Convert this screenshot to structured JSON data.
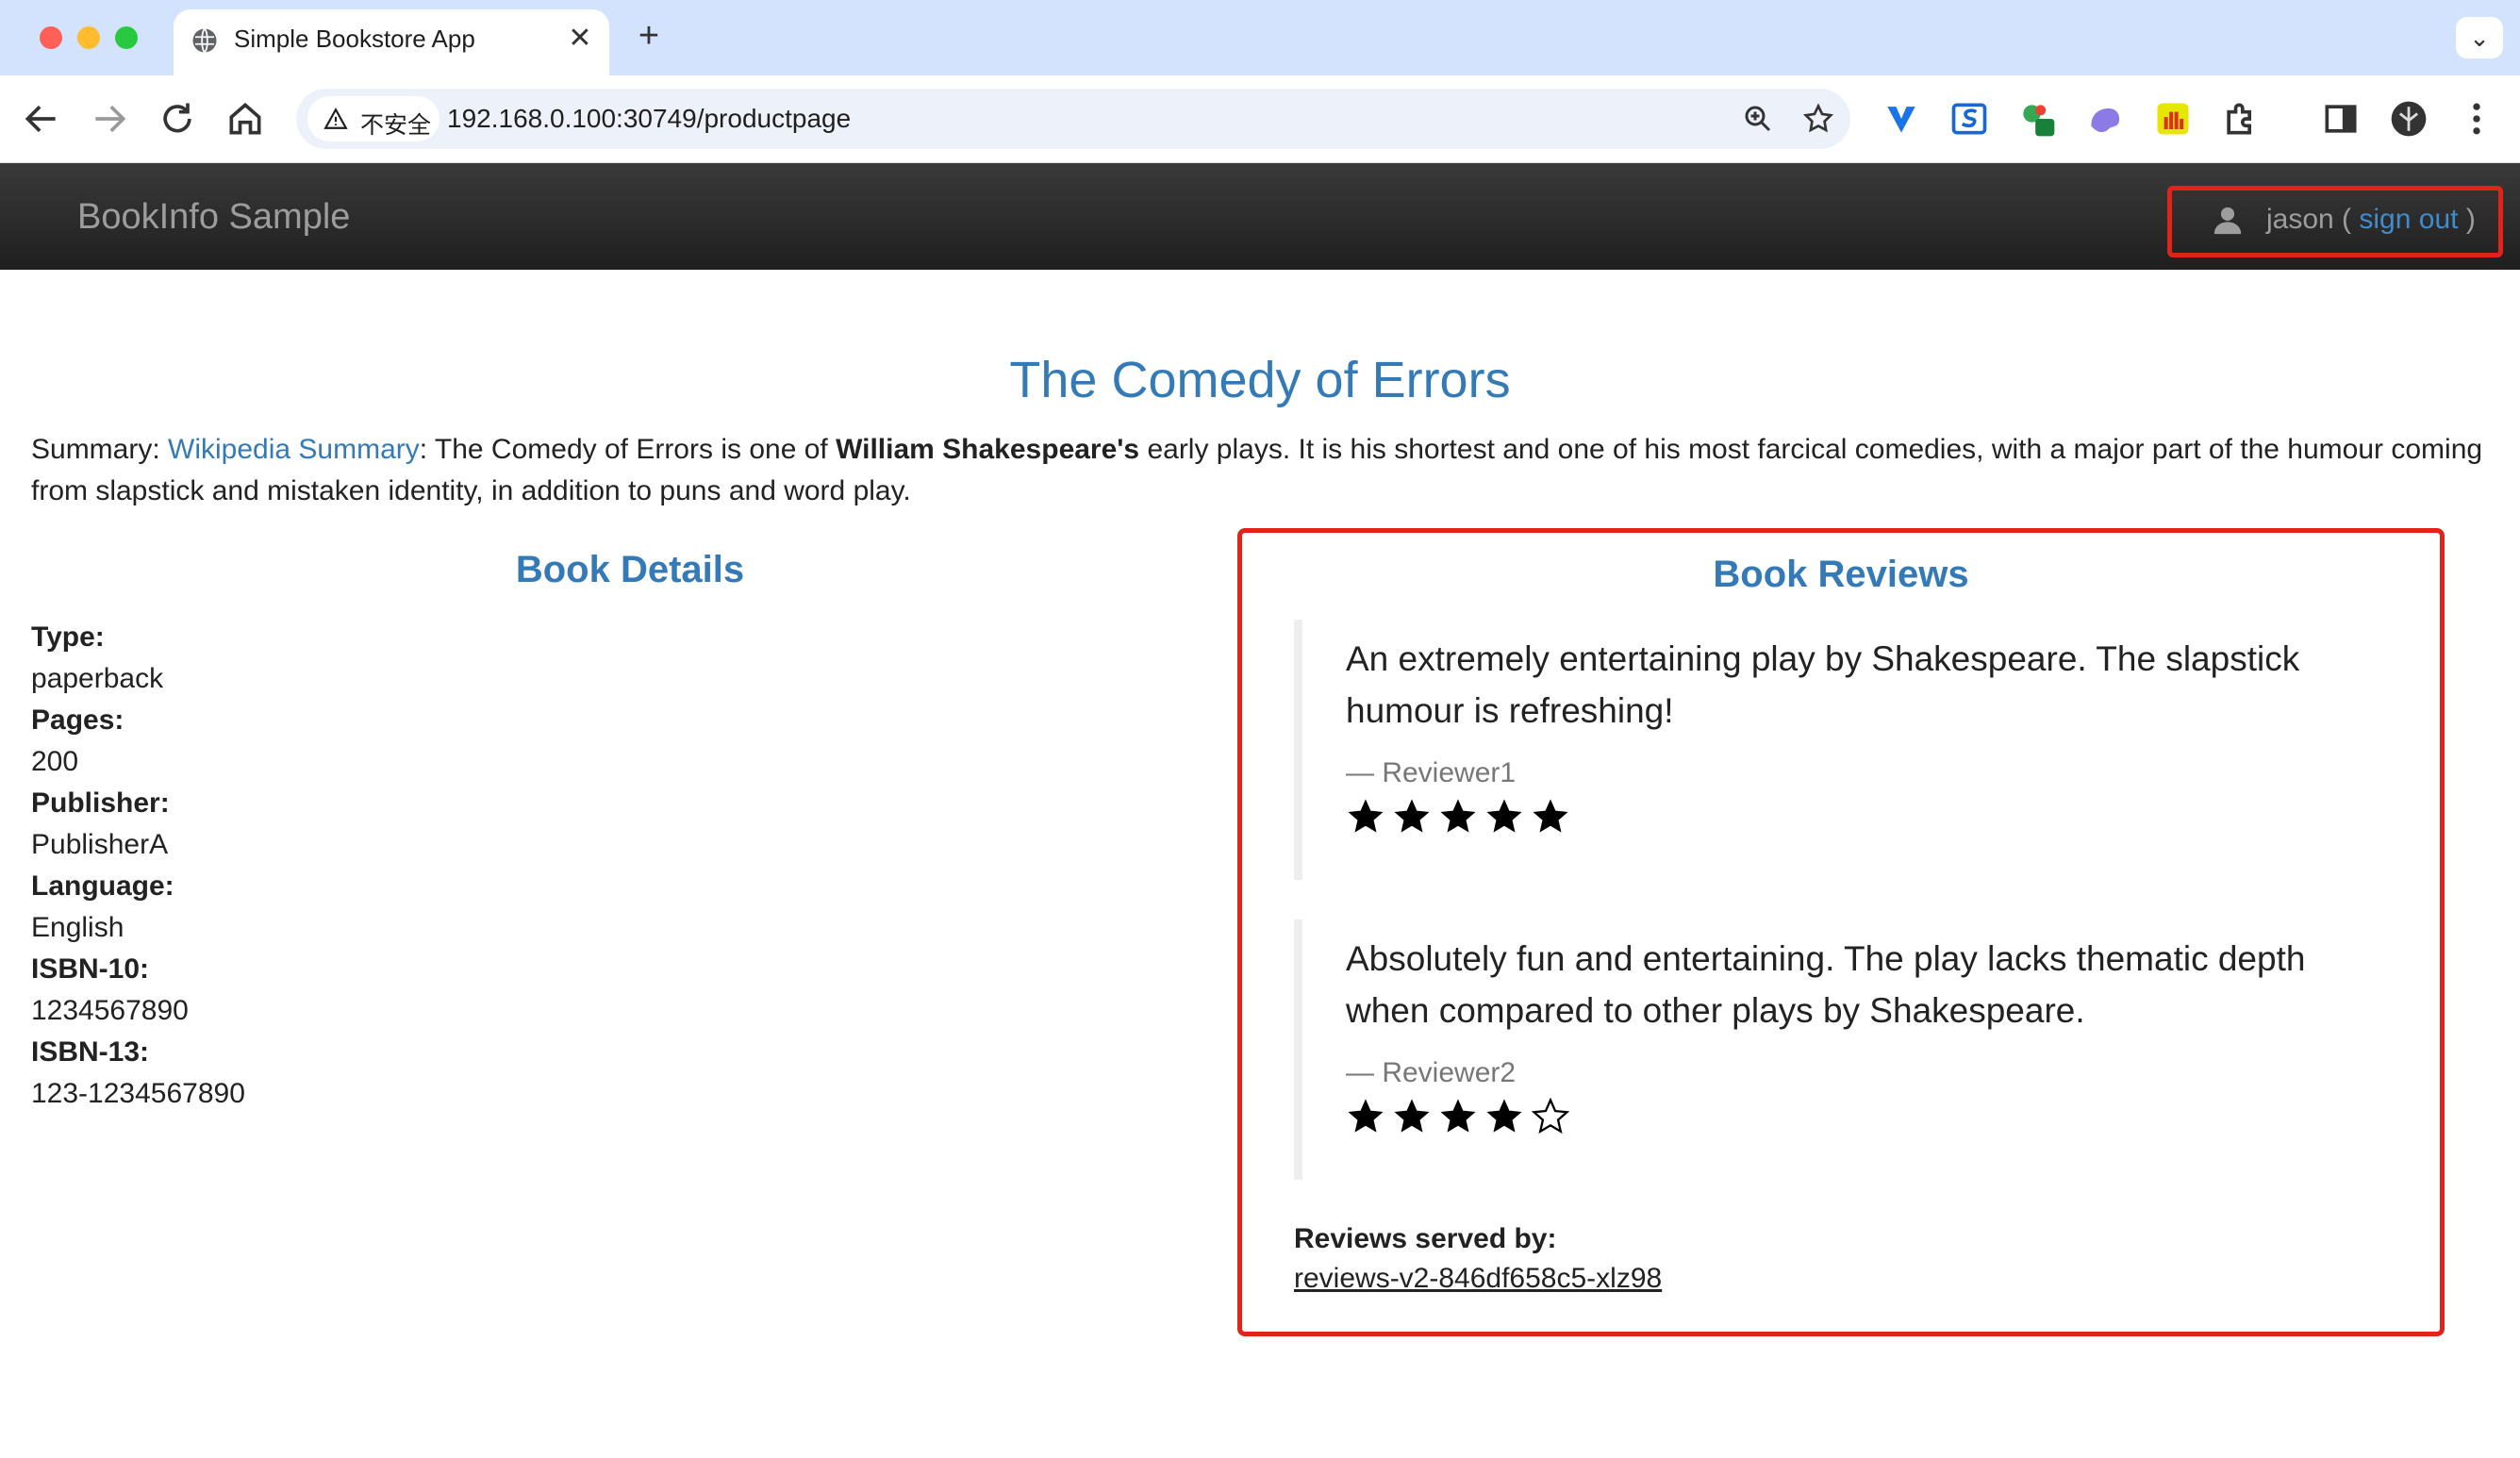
{
  "browser": {
    "tab_title": "Simple Bookstore App",
    "new_tab_label": "+",
    "security_label": "不安全",
    "url": "192.168.0.100:30749/productpage"
  },
  "navbar": {
    "brand": "BookInfo Sample",
    "user_name": "jason (",
    "sign_out": "sign out",
    "close_paren": ")"
  },
  "page": {
    "title": "The Comedy of Errors",
    "summary": {
      "label": "Summary: ",
      "link": "Wikipedia Summary",
      "text_1": ": The Comedy of Errors is one of ",
      "bold": "William Shakespeare's",
      "text_2": " early plays. It is his shortest and one of his most farcical comedies, with a major part of the humour coming from slapstick and mistaken identity, in addition to puns and word play."
    }
  },
  "details": {
    "heading": "Book Details",
    "fields": [
      {
        "label": "Type:",
        "value": "paperback"
      },
      {
        "label": "Pages:",
        "value": "200"
      },
      {
        "label": "Publisher:",
        "value": "PublisherA"
      },
      {
        "label": "Language:",
        "value": "English"
      },
      {
        "label": "ISBN-10:",
        "value": "1234567890"
      },
      {
        "label": "ISBN-13:",
        "value": "123-1234567890"
      }
    ]
  },
  "reviews": {
    "heading": "Book Reviews",
    "items": [
      {
        "text": "An extremely entertaining play by Shakespeare. The slapstick humour is refreshing!",
        "reviewer": "— Reviewer1",
        "rating": 5,
        "max": 5
      },
      {
        "text": "Absolutely fun and entertaining. The play lacks thematic depth when compared to other plays by Shakespeare.",
        "reviewer": "— Reviewer2",
        "rating": 4,
        "max": 5
      }
    ],
    "served_by_label": "Reviews served by:",
    "served_by_pod": "reviews-v2-846df658c5-xlz98"
  },
  "colors": {
    "link": "#337ab7",
    "highlight_border": "#e2231a",
    "navbar_bg": "#222222",
    "tab_strip": "#d3e3fd"
  }
}
